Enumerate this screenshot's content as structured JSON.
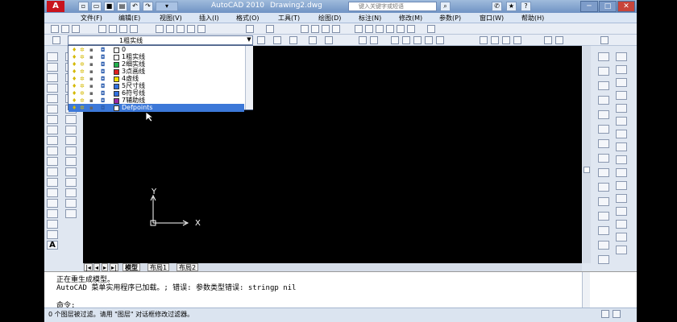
{
  "titlebar": {
    "logo": "A",
    "app_title": "AutoCAD 2010",
    "file_title": "Drawing2.dwg",
    "search_placeholder": "键入关键字或短语"
  },
  "menu": {
    "items": [
      "文件(F)",
      "编辑(E)",
      "视图(V)",
      "插入(I)",
      "格式(O)",
      "工具(T)",
      "绘图(D)",
      "标注(N)",
      "修改(M)",
      "参数(P)",
      "窗口(W)",
      "帮助(H)"
    ]
  },
  "layer_combo": {
    "current": "1粗实线"
  },
  "layers": [
    {
      "name": "0",
      "color": "#ffffff"
    },
    {
      "name": "1粗实线",
      "color": "#ffffff"
    },
    {
      "name": "2细实线",
      "color": "#22b14c"
    },
    {
      "name": "3点画线",
      "color": "#e02020"
    },
    {
      "name": "4虚线",
      "color": "#f0e000"
    },
    {
      "name": "5尺寸线",
      "color": "#3070e0"
    },
    {
      "name": "6符号线",
      "color": "#3070e0"
    },
    {
      "name": "7辅助线",
      "color": "#9a2aa8"
    },
    {
      "name": "Defpoints",
      "color": "#ffffff"
    }
  ],
  "selected_layer": "Defpoints",
  "ucs": {
    "x_label": "X",
    "y_label": "Y"
  },
  "layout_tabs": [
    "模型",
    "布局1",
    "布局2"
  ],
  "command": {
    "lines": [
      "正在重生成模型。",
      "AutoCAD 菜单实用程序已加载。; 错误: 参数类型错误: stringp nil"
    ],
    "prompt": "命令:"
  },
  "status": {
    "text": "0 个图层被过滤。请用 \"图层\" 对话框修改过滤器。"
  },
  "colors": {
    "canvas": "#000000",
    "accent": "#3c78d8"
  }
}
